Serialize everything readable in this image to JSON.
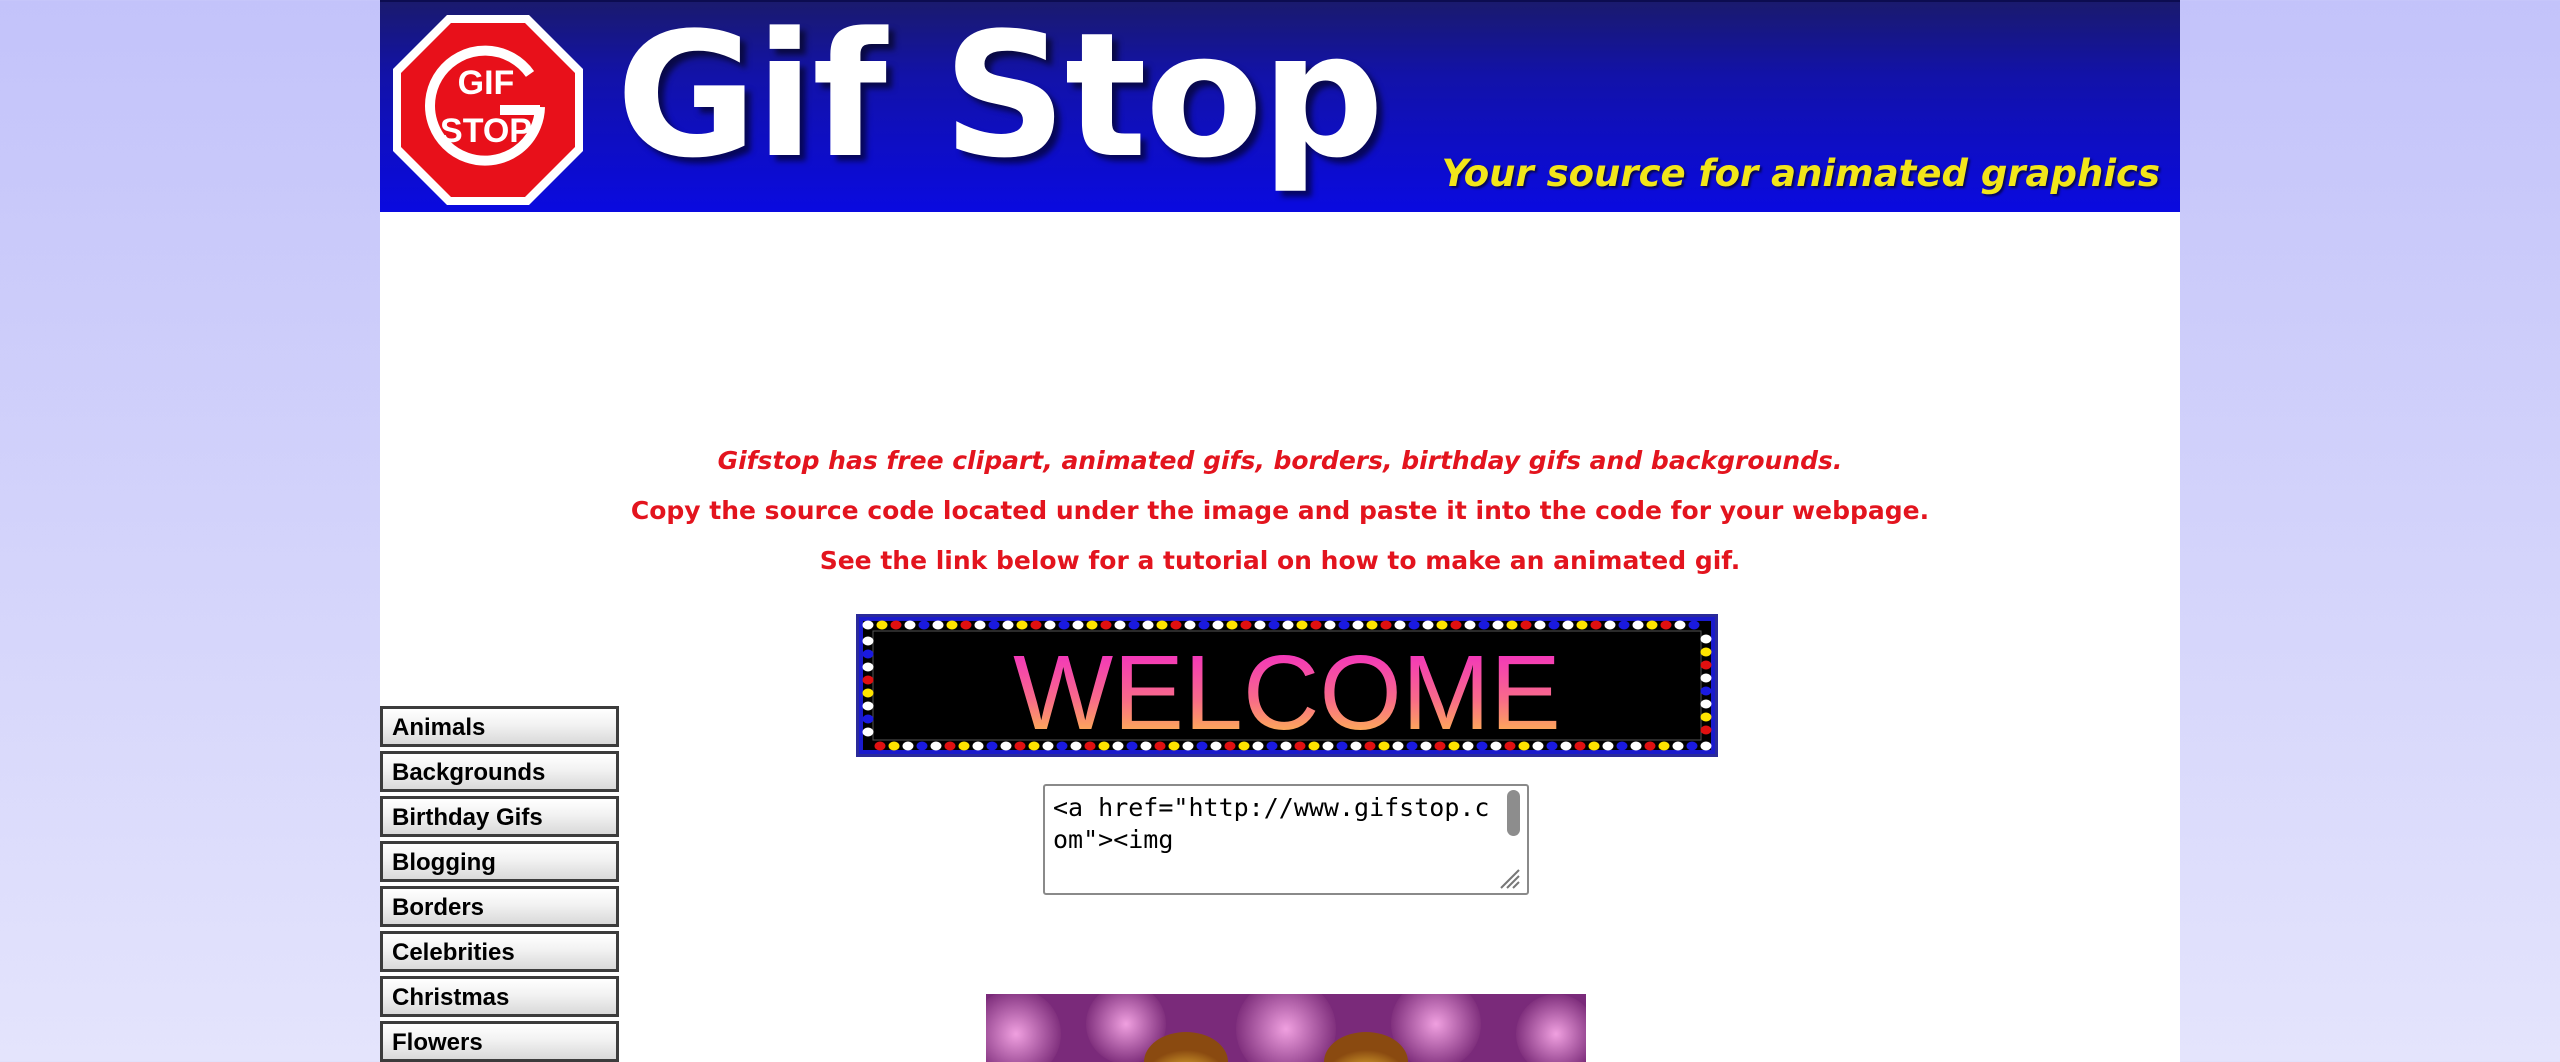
{
  "site": {
    "logo_text_top": "GIF",
    "logo_text_bottom": "STOP",
    "title": "Gif Stop",
    "tagline": "Your source for animated graphics"
  },
  "intro": {
    "line1": "Gifstop has free clipart, animated gifs, borders, birthday gifs and backgrounds.",
    "line2": "Copy the source code located under the image and paste it into the code for your webpage.",
    "line3": "See the link below for a tutorial on how to make an animated gif."
  },
  "welcome_banner": {
    "text": "WELCOME"
  },
  "code_box": {
    "value": "<a href=\"http://www.gifstop.com\"><img"
  },
  "sidebar": {
    "items": [
      {
        "label": "Animals"
      },
      {
        "label": "Backgrounds"
      },
      {
        "label": "Birthday Gifs"
      },
      {
        "label": "Blogging"
      },
      {
        "label": "Borders"
      },
      {
        "label": "Celebrities"
      },
      {
        "label": "Christmas"
      },
      {
        "label": "Flowers"
      }
    ]
  },
  "colors": {
    "banner_blue": "#0a0ae0",
    "tagline_yellow": "#f2e61a",
    "intro_red": "#e3141e",
    "logo_red": "#e8101a"
  },
  "icons": {
    "logo": "stop-sign-icon",
    "scrollbar": "scrollbar-thumb",
    "resize": "resize-grip-icon"
  }
}
